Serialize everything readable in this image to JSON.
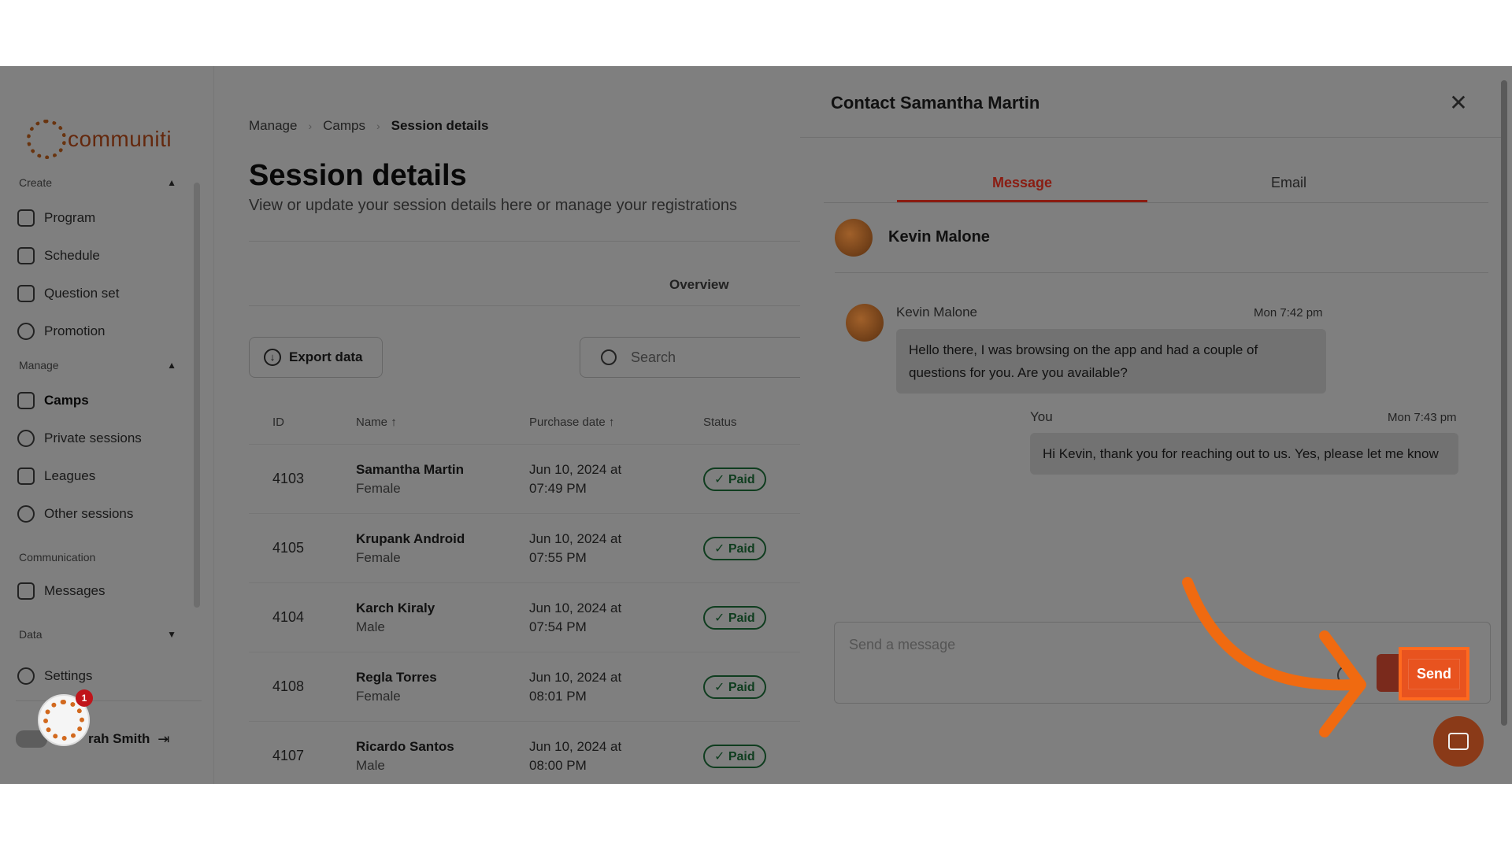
{
  "brand": {
    "name": "communiti",
    "accent": "#c8501a"
  },
  "sidebar": {
    "sections": {
      "create": "Create",
      "manage": "Manage",
      "communication": "Communication",
      "data": "Data"
    },
    "items": [
      {
        "label": "Program",
        "icon": "program-icon"
      },
      {
        "label": "Schedule",
        "icon": "schedule-icon"
      },
      {
        "label": "Question set",
        "icon": "question-set-icon"
      },
      {
        "label": "Promotion",
        "icon": "promotion-icon"
      },
      {
        "label": "Camps",
        "icon": "camps-icon",
        "active": true
      },
      {
        "label": "Private sessions",
        "icon": "private-sessions-icon"
      },
      {
        "label": "Leagues",
        "icon": "leagues-icon"
      },
      {
        "label": "Other sessions",
        "icon": "other-sessions-icon"
      },
      {
        "label": "Messages",
        "icon": "messages-icon"
      },
      {
        "label": "Settings",
        "icon": "gear-icon"
      }
    ],
    "user_name": "rah Smith",
    "help_badge_count": "1"
  },
  "main": {
    "breadcrumb": [
      "Manage",
      "Camps",
      "Session details"
    ],
    "title": "Session details",
    "subtitle": "View or update your session details here or manage your registrations",
    "tab_overview": "Overview",
    "export_label": "Export data",
    "search_placeholder": "Search",
    "table": {
      "headers": {
        "id": "ID",
        "name": "Name",
        "purchase_date": "Purchase date",
        "status": "Status"
      },
      "rows": [
        {
          "id": "4103",
          "name": "Samantha Martin",
          "gender": "Female",
          "date1": "Jun 10, 2024 at",
          "date2": "07:49 PM",
          "status": "✓ Paid"
        },
        {
          "id": "4105",
          "name": "Krupank Android",
          "gender": "Female",
          "date1": "Jun 10, 2024 at",
          "date2": "07:55 PM",
          "status": "✓ Paid"
        },
        {
          "id": "4104",
          "name": "Karch Kiraly",
          "gender": "Male",
          "date1": "Jun 10, 2024 at",
          "date2": "07:54 PM",
          "status": "✓ Paid"
        },
        {
          "id": "4108",
          "name": "Regla Torres",
          "gender": "Female",
          "date1": "Jun 10, 2024 at",
          "date2": "08:01 PM",
          "status": "✓ Paid"
        },
        {
          "id": "4107",
          "name": "Ricardo Santos",
          "gender": "Male",
          "date1": "Jun 10, 2024 at",
          "date2": "08:00 PM",
          "status": "✓ Paid"
        }
      ]
    }
  },
  "drawer": {
    "title": "Contact Samantha Martin",
    "tabs": {
      "message": "Message",
      "email": "Email"
    },
    "contact_name": "Kevin Malone",
    "messages": [
      {
        "sender": "Kevin Malone",
        "time": "Mon 7:42 pm",
        "text": "Hello there, I was browsing on the app and had a couple of questions for you. Are you available?"
      },
      {
        "sender": "You",
        "time": "Mon 7:43 pm",
        "text": "Hi Kevin, thank you for reaching out to us. Yes, please let me know"
      }
    ],
    "compose_placeholder": "Send a message",
    "send_label": "Send"
  },
  "colors": {
    "highlight": "#e8531f",
    "arrow": "#f06a10",
    "paid": "#1f7a3e"
  }
}
